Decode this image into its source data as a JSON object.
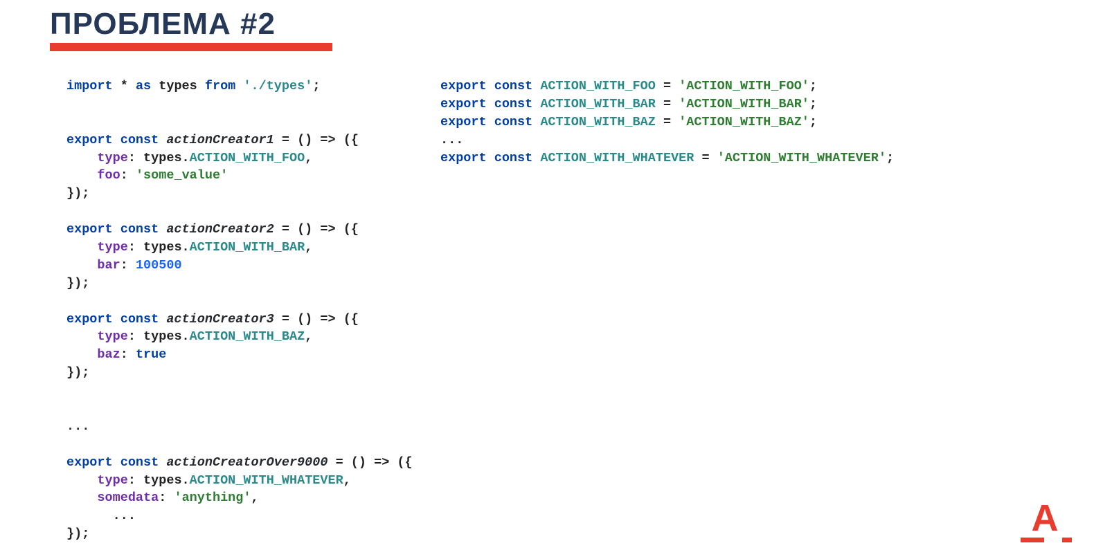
{
  "title": "ПРОБЛЕМА #2",
  "colors": {
    "heading": "#253858",
    "accent": "#e83c2e",
    "keyword": "#003ea8",
    "property": "#6f2da8",
    "member": "#2a8a8a",
    "string": "#2f7d32",
    "number": "#1a63ff"
  },
  "left_code": {
    "lines": [
      [
        {
          "t": "import ",
          "c": "kw"
        },
        {
          "t": "* ",
          "c": "op"
        },
        {
          "t": "as ",
          "c": "kw"
        },
        {
          "t": "types ",
          "c": "plain"
        },
        {
          "t": "from ",
          "c": "kw"
        },
        {
          "t": "'./types'",
          "c": "strp"
        },
        {
          "t": ";",
          "c": "plain"
        }
      ],
      [
        {
          "t": "",
          "c": "plain"
        }
      ],
      [
        {
          "t": "",
          "c": "plain"
        }
      ],
      [
        {
          "t": "export const ",
          "c": "kw"
        },
        {
          "t": "actionCreator1",
          "c": "id"
        },
        {
          "t": " = () ",
          "c": "plain"
        },
        {
          "t": "=>",
          "c": "op"
        },
        {
          "t": " ({",
          "c": "plain"
        }
      ],
      [
        {
          "t": "    ",
          "c": "plain"
        },
        {
          "t": "type",
          "c": "propkey"
        },
        {
          "t": ": types.",
          "c": "plain"
        },
        {
          "t": "ACTION_WITH_FOO",
          "c": "member"
        },
        {
          "t": ",",
          "c": "plain"
        }
      ],
      [
        {
          "t": "    ",
          "c": "plain"
        },
        {
          "t": "foo",
          "c": "propkey"
        },
        {
          "t": ": ",
          "c": "plain"
        },
        {
          "t": "'some_value'",
          "c": "str"
        }
      ],
      [
        {
          "t": "});",
          "c": "plain"
        }
      ],
      [
        {
          "t": "",
          "c": "plain"
        }
      ],
      [
        {
          "t": "export const ",
          "c": "kw"
        },
        {
          "t": "actionCreator2",
          "c": "id"
        },
        {
          "t": " = () ",
          "c": "plain"
        },
        {
          "t": "=>",
          "c": "op"
        },
        {
          "t": " ({",
          "c": "plain"
        }
      ],
      [
        {
          "t": "    ",
          "c": "plain"
        },
        {
          "t": "type",
          "c": "propkey"
        },
        {
          "t": ": types.",
          "c": "plain"
        },
        {
          "t": "ACTION_WITH_BAR",
          "c": "member"
        },
        {
          "t": ",",
          "c": "plain"
        }
      ],
      [
        {
          "t": "    ",
          "c": "plain"
        },
        {
          "t": "bar",
          "c": "propkey"
        },
        {
          "t": ": ",
          "c": "plain"
        },
        {
          "t": "100500",
          "c": "num"
        }
      ],
      [
        {
          "t": "});",
          "c": "plain"
        }
      ],
      [
        {
          "t": "",
          "c": "plain"
        }
      ],
      [
        {
          "t": "export const ",
          "c": "kw"
        },
        {
          "t": "actionCreator3",
          "c": "id"
        },
        {
          "t": " = () ",
          "c": "plain"
        },
        {
          "t": "=>",
          "c": "op"
        },
        {
          "t": " ({",
          "c": "plain"
        }
      ],
      [
        {
          "t": "    ",
          "c": "plain"
        },
        {
          "t": "type",
          "c": "propkey"
        },
        {
          "t": ": types.",
          "c": "plain"
        },
        {
          "t": "ACTION_WITH_BAZ",
          "c": "member"
        },
        {
          "t": ",",
          "c": "plain"
        }
      ],
      [
        {
          "t": "    ",
          "c": "plain"
        },
        {
          "t": "baz",
          "c": "propkey"
        },
        {
          "t": ": ",
          "c": "plain"
        },
        {
          "t": "true",
          "c": "kw"
        }
      ],
      [
        {
          "t": "});",
          "c": "plain"
        }
      ],
      [
        {
          "t": "",
          "c": "plain"
        }
      ],
      [
        {
          "t": "",
          "c": "plain"
        }
      ],
      [
        {
          "t": "...",
          "c": "plain"
        }
      ],
      [
        {
          "t": "",
          "c": "plain"
        }
      ],
      [
        {
          "t": "export const ",
          "c": "kw"
        },
        {
          "t": "actionCreatorOver9000",
          "c": "id"
        },
        {
          "t": " = () ",
          "c": "plain"
        },
        {
          "t": "=>",
          "c": "op"
        },
        {
          "t": " ({",
          "c": "plain"
        }
      ],
      [
        {
          "t": "    ",
          "c": "plain"
        },
        {
          "t": "type",
          "c": "propkey"
        },
        {
          "t": ": types.",
          "c": "plain"
        },
        {
          "t": "ACTION_WITH_WHATEVER",
          "c": "member"
        },
        {
          "t": ",",
          "c": "plain"
        }
      ],
      [
        {
          "t": "    ",
          "c": "plain"
        },
        {
          "t": "somedata",
          "c": "propkey"
        },
        {
          "t": ": ",
          "c": "plain"
        },
        {
          "t": "'anything'",
          "c": "str"
        },
        {
          "t": ",",
          "c": "plain"
        }
      ],
      [
        {
          "t": "      ...",
          "c": "plain"
        }
      ],
      [
        {
          "t": "});",
          "c": "plain"
        }
      ]
    ]
  },
  "right_code": {
    "lines": [
      [
        {
          "t": "export const ",
          "c": "kw"
        },
        {
          "t": "ACTION_WITH_FOO",
          "c": "member"
        },
        {
          "t": " = ",
          "c": "plain"
        },
        {
          "t": "'ACTION_WITH_FOO'",
          "c": "str"
        },
        {
          "t": ";",
          "c": "plain"
        }
      ],
      [
        {
          "t": "export const ",
          "c": "kw"
        },
        {
          "t": "ACTION_WITH_BAR",
          "c": "member"
        },
        {
          "t": " = ",
          "c": "plain"
        },
        {
          "t": "'ACTION_WITH_BAR'",
          "c": "str"
        },
        {
          "t": ";",
          "c": "plain"
        }
      ],
      [
        {
          "t": "export const ",
          "c": "kw"
        },
        {
          "t": "ACTION_WITH_BAZ",
          "c": "member"
        },
        {
          "t": " = ",
          "c": "plain"
        },
        {
          "t": "'ACTION_WITH_BAZ'",
          "c": "str"
        },
        {
          "t": ";",
          "c": "plain"
        }
      ],
      [
        {
          "t": "...",
          "c": "plain"
        }
      ],
      [
        {
          "t": "export const ",
          "c": "kw"
        },
        {
          "t": "ACTION_WITH_WHATEVER",
          "c": "member"
        },
        {
          "t": " = ",
          "c": "plain"
        },
        {
          "t": "'ACTION_WITH_WHATEVER'",
          "c": "str"
        },
        {
          "t": ";",
          "c": "plain"
        }
      ]
    ]
  },
  "logo": {
    "letter": "А"
  }
}
